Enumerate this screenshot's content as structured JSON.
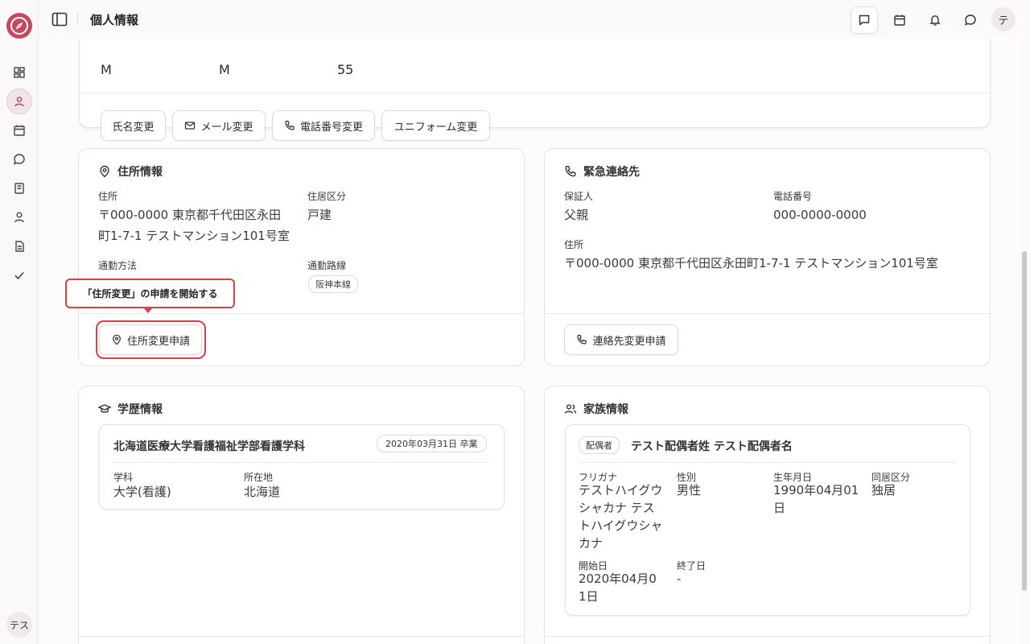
{
  "header": {
    "title": "個人情報",
    "avatar_text": "テ"
  },
  "sidebar": {
    "avatar_text": "テス",
    "icons": [
      "dashboard-icon",
      "user-icon",
      "calendar-icon",
      "chat-icon",
      "book-icon",
      "person-icon",
      "document-icon",
      "check-icon"
    ]
  },
  "top_card": {
    "values": [
      "M",
      "M",
      "55"
    ],
    "buttons": {
      "name_change": "氏名変更",
      "email_change": "メール変更",
      "phone_change": "電話番号変更",
      "uniform_change": "ユニフォーム変更"
    }
  },
  "address": {
    "title": "住所情報",
    "address_label": "住所",
    "address_value_line1": "〒000-0000 東京都千代田区永田",
    "address_value_line2": "町1-7-1 テストマンション101号室",
    "residence_label": "住居区分",
    "residence_value": "戸建",
    "commute_method_label": "通勤方法",
    "commute_route_label": "通勤路線",
    "commute_route_tag": "阪神本線",
    "callout": "「住所変更」の申請を開始する",
    "change_button": "住所変更申請"
  },
  "emergency": {
    "title": "緊急連絡先",
    "guarantor_label": "保証人",
    "guarantor_value": "父親",
    "phone_label": "電話番号",
    "phone_value": "000-0000-0000",
    "address_label": "住所",
    "address_value": "〒000-0000 東京都千代田区永田町1-7-1 テストマンション101号室",
    "change_button": "連絡先変更申請"
  },
  "education": {
    "title": "学歴情報",
    "school": "北海道医療大学看護福祉学部看護学科",
    "graduation": "2020年03月31日 卒業",
    "dept_label": "学科",
    "dept_value": "大学(看護)",
    "location_label": "所在地",
    "location_value": "北海道"
  },
  "family": {
    "title": "家族情報",
    "relation_badge": "配偶者",
    "name": "テスト配偶者姓 テスト配偶者名",
    "furigana_label": "フリガナ",
    "furigana_lines": [
      "テストハイグウ",
      "シャカナ テス",
      "トハイグウシャ",
      "カナ"
    ],
    "gender_label": "性別",
    "gender_value": "男性",
    "birth_label": "生年月日",
    "birth_lines": [
      "1990年04月01",
      "日"
    ],
    "cohabit_label": "同居区分",
    "cohabit_value": "独居",
    "start_label": "開始日",
    "start_lines": [
      "2020年04月0",
      "1日"
    ],
    "end_label": "終了日",
    "end_value": "-"
  }
}
